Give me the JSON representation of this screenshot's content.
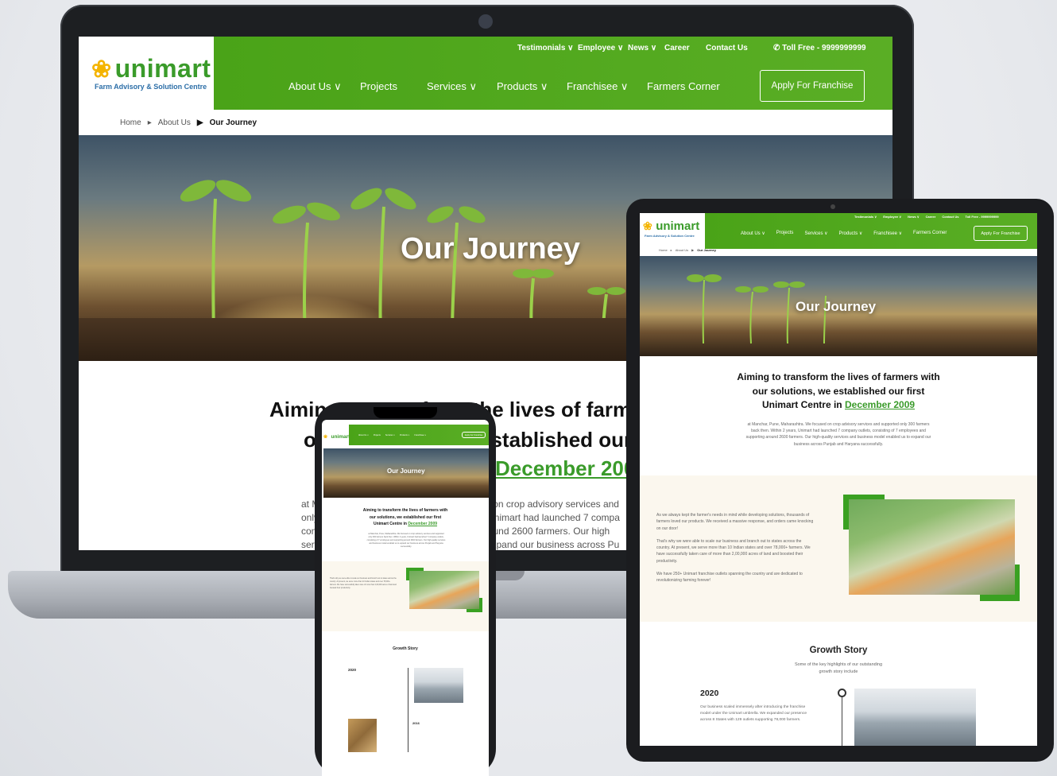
{
  "brand": {
    "name": "unimart",
    "tagline": "Farm Advisory & Solution Centre"
  },
  "top_nav": [
    "Testimonials ∨",
    "Employee ∨",
    "News ∨",
    "Career",
    "Contact Us"
  ],
  "toll_free": "Toll Free - 9999999999",
  "main_nav": [
    "About Us ∨",
    "Projects",
    "Services ∨",
    "Products ∨",
    "Franchisee ∨",
    "Farmers Corner"
  ],
  "cta": "Apply For Franchise",
  "breadcrumb": {
    "home": "Home",
    "about": "About Us",
    "current": "Our Journey"
  },
  "hero_title": "Our Journey",
  "intro": {
    "laptop_line1": "Aiming to transform the lives of farmers with",
    "laptop_line2": "our solutions, we established our first",
    "laptop_line3": "December 2009",
    "heading_line1": "Aiming to transform the lives of farmers with",
    "heading_line2": "our solutions, we established our first",
    "heading_line3_prefix": "Unimart Centre in",
    "heading_line3_highlight": "December 2009",
    "paragraph": "at Manchar, Pune, Maharashtra. We focused on crop advisory services and supported only 300 farmers back then. Within 2 years, Unimart had launched 7 company outlets, consisting of 7 employees and supporting around 2600 farmers. Our high-quality services and business model enabled us to expand our business across Punjab and Haryana successfully.",
    "laptop_para_lines": [
      "at Manchar, Pune, Maharashtra. We focused on crop advisory services and",
      "only 300 farmers back then. Within 2 years, Unimart had launched 7 compa",
      "consisting of 7 employees and supporting around 2600 farmers. Our high",
      "services and business model enabled us to expand our business across Pu"
    ]
  },
  "scale": {
    "p1": "As we always kept the farmer's needs in mind while developing solutions, thousands of farmers loved our products. We received a massive response, and orders came knocking on our door!",
    "p2": "That's why we were able to scale our business and branch out to states across the country. At present, we serve more than 10 Indian states and over 78,000+ farmers. We have successfully taken care of more than 2,00,000 acres of land and boosted their productivity.",
    "p3": "We have 250+ Unimart franchise outlets spanning the country and are dedicated to revolutionizing farming forever!"
  },
  "growth": {
    "title": "Growth Story",
    "subtitle_line1": "Some of the key highlights of our outstanding",
    "subtitle_line2": "growth story include",
    "year1": "2020",
    "year1_text": "Our business scaled immensely after introducing the franchise model under the Unimart umbrella. We expanded our presence across 8 States with 129 outlets supporting 78,000 farmers.",
    "year2": "2016"
  }
}
